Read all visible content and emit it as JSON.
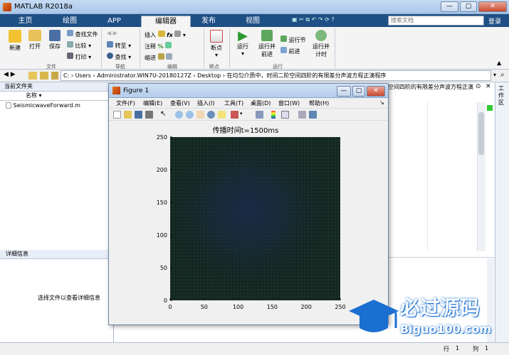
{
  "app": {
    "title": "MATLAB R2018a"
  },
  "tabs": [
    "主页",
    "绘图",
    "APP",
    "编辑器",
    "发布",
    "视图"
  ],
  "active_tab": "编辑器",
  "search_placeholder": "搜索文档",
  "login_label": "登录",
  "ribbon": {
    "file": {
      "new": "新建",
      "open": "打开",
      "save": "保存",
      "find_files": "查找文件",
      "compare": "比较",
      "print": "打印",
      "group": "文件"
    },
    "nav": {
      "goto": "转至",
      "find": "查找",
      "group": "导航"
    },
    "edit": {
      "insert": "插入",
      "comment": "注释",
      "indent": "缩进",
      "group": "编辑"
    },
    "breakpoints": {
      "label": "断点",
      "group": "断点"
    },
    "run": {
      "run": "运行",
      "run_advance": "运行并\n前进",
      "run_section": "运行节",
      "advance": "前进",
      "run_time": "运行并\n计时",
      "group": "运行"
    }
  },
  "address": {
    "path": "C: › Users › Administrator.WIN7U-20180127Z › Desktop › 在均匀介质中，时间二阶空间四阶的有限差分声波方程正演程序"
  },
  "current_folder": {
    "title": "当前文件夹",
    "column": "名称",
    "files": [
      "SeismicwaveForward.m"
    ]
  },
  "details": {
    "title": "详细信息",
    "hint": "选择文件以查看详细信息"
  },
  "editor": {
    "tab_text": "空间四阶的有限差分声波方程正演程..."
  },
  "workspace_label": "工作区",
  "status": {
    "row_label": "行",
    "row": "1",
    "col_label": "列",
    "col": "1"
  },
  "figure": {
    "title": "Figure 1",
    "menus": [
      "文件(F)",
      "编辑(E)",
      "查看(V)",
      "插入(I)",
      "工具(T)",
      "桌面(D)",
      "窗口(W)",
      "帮助(H)"
    ],
    "plot_title": "传播时间t=1500ms"
  },
  "chart_data": {
    "type": "heatmap",
    "title": "传播时间t=1500ms",
    "xlim": [
      0,
      250
    ],
    "ylim": [
      0,
      250
    ],
    "xticks": [
      0,
      50,
      100,
      150,
      200,
      250
    ],
    "yticks": [
      0,
      50,
      100,
      150,
      200,
      250
    ],
    "colors": {
      "background": "#0e1a17",
      "wave": "#1a2a4a",
      "grid": "#2f5a4a"
    }
  },
  "watermark": {
    "cn": "必过源码",
    "url": "Biguo100.com"
  }
}
